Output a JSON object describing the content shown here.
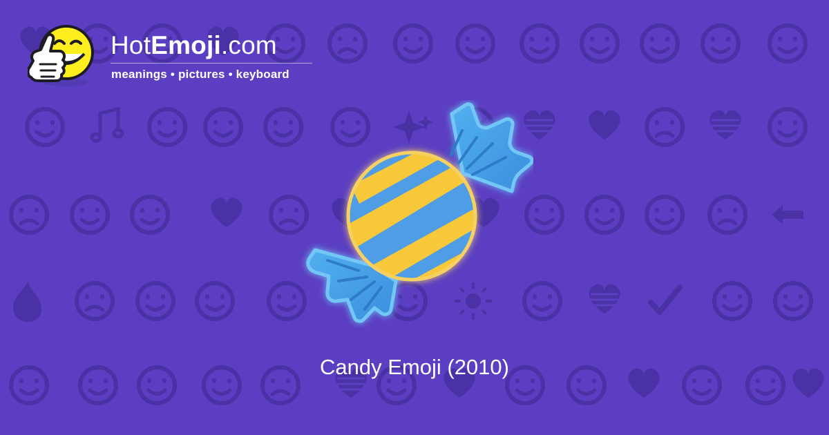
{
  "brand": {
    "hot": "Hot",
    "emoji": "Emoji",
    "com": ".com",
    "tagline": "meanings • pictures • keyboard"
  },
  "hero": {
    "icon_name": "candy-icon"
  },
  "caption": "Candy Emoji (2010)",
  "colors": {
    "background": "#5b3ec1",
    "pattern": "#4a31a6",
    "text": "#ffffff",
    "candy_blue": "#4f9de4",
    "candy_yellow": "#f8c83a",
    "wrapper_blue": "#47a7ea"
  },
  "background_icons": [
    "heart-icon",
    "winking-face-icon",
    "kissing-face-icon",
    "two-hearts-icon",
    "smiling-face-icon",
    "weary-face-icon",
    "ok-hand-icon",
    "neutral-face-icon",
    "eyes-icon",
    "smirking-face-icon",
    "relieved-face-icon",
    "beaming-face-icon",
    "recycling-icon",
    "raising-hands-icon",
    "musical-notes-icon",
    "see-no-evil-monkey-icon",
    "victory-hand-icon",
    "sleeping-face-icon",
    "grinning-face-icon",
    "sparkles-icon",
    "laughing-face-icon",
    "heart-pattern-icon",
    "broken-heart-icon",
    "confused-face-icon",
    "heart-pattern-icon",
    "tongue-face-icon",
    "frowning-face-icon",
    "tongue-face-icon",
    "hand-down-icon",
    "heart-with-arrow-icon",
    "tired-face-icon",
    "revolving-hearts-icon",
    "heart-outline-icon",
    "monkey-face-icon",
    "screaming-face-icon",
    "smiling-imp-icon",
    "angry-face-icon",
    "left-arrow-icon",
    "fire-icon",
    "tired-face-icon",
    "punch-icon",
    "party-popper-icon",
    "squinting-tongue-face-icon",
    "rose-icon",
    "sun-icon",
    "flexed-biceps-icon",
    "heart-pattern-icon",
    "check-mark-icon",
    "laughing-face-icon",
    "new-moon-face-icon",
    "heart-eyes-cat-icon",
    "waving-hand-icon",
    "mask-face-icon",
    "camera-icon",
    "sad-face-icon",
    "heart-pattern-icon",
    "grinning-face-icon",
    "beating-heart-icon",
    "kissing-face-icon",
    "smiling-face-icon"
  ]
}
